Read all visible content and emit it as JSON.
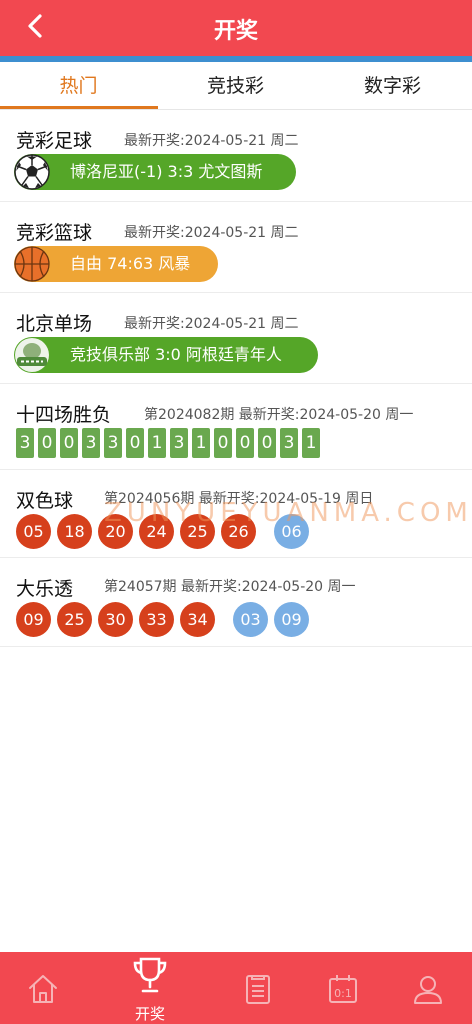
{
  "header": {
    "title": "开奖",
    "back_icon": "chevron-left-icon"
  },
  "tabs": [
    {
      "label": "热门",
      "active": true
    },
    {
      "label": "竞技彩",
      "active": false
    },
    {
      "label": "数字彩",
      "active": false
    }
  ],
  "sports": [
    {
      "name": "竞彩足球",
      "date": "最新开奖:2024-05-21 周二",
      "result": "博洛尼亚(-1) 3:3 尤文图斯",
      "icon": "soccer-ball-icon",
      "color": "#55a628"
    },
    {
      "name": "竞彩篮球",
      "date": "最新开奖:2024-05-21 周二",
      "result": "自由 74:63 风暴",
      "icon": "basketball-icon",
      "color": "#eea535"
    },
    {
      "name": "北京单场",
      "date": "最新开奖:2024-05-21 周二",
      "result": "竞技俱乐部 3:0 阿根廷青年人",
      "icon": "beijing-single-logo-icon",
      "color": "#55a628"
    }
  ],
  "shisichang": {
    "name": "十四场胜负",
    "info": "第2024082期 最新开奖:2024-05-20 周一",
    "digits": [
      "3",
      "0",
      "0",
      "3",
      "3",
      "0",
      "1",
      "3",
      "1",
      "0",
      "0",
      "0",
      "3",
      "1"
    ]
  },
  "shuangseqiu": {
    "name": "双色球",
    "info": "第2024056期 最新开奖:2024-05-19 周日",
    "red": [
      "05",
      "18",
      "20",
      "24",
      "25",
      "26"
    ],
    "blue": [
      "06"
    ]
  },
  "daletou": {
    "name": "大乐透",
    "info": "第24057期 最新开奖:2024-05-20 周一",
    "red": [
      "09",
      "25",
      "30",
      "33",
      "34"
    ],
    "blue": [
      "03",
      "09"
    ]
  },
  "watermark": "ZUNYUEYUANMA.COM",
  "bottom_nav": [
    {
      "icon": "home-icon",
      "label": ""
    },
    {
      "icon": "trophy-icon",
      "label": "开奖",
      "active": true
    },
    {
      "icon": "clipboard-icon",
      "label": ""
    },
    {
      "icon": "scoreboard-icon",
      "label": ""
    },
    {
      "icon": "user-icon",
      "label": ""
    }
  ],
  "colors": {
    "brand_red": "#f24850",
    "strip_blue": "#3d8fd0",
    "active_tab": "#e0781e",
    "ball_red": "#d6401c",
    "ball_blue": "#79aee4",
    "digit_green": "#6aa84f"
  }
}
